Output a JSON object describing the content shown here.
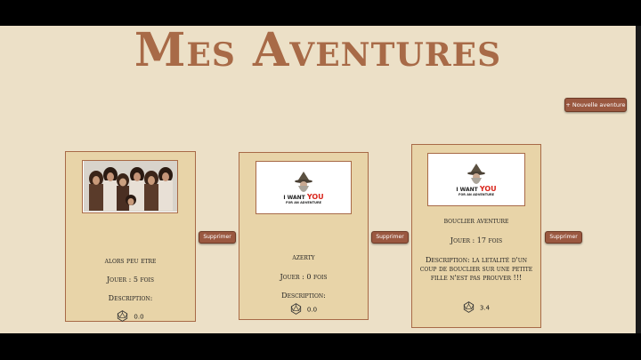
{
  "page": {
    "title": "Mes Aventures",
    "new_adventure_label": "+ Nouvelle aventure"
  },
  "cards": [
    {
      "name": "alors peu etre",
      "played": "Jouer : 5 fois",
      "description": "Description:",
      "rating": "0.0",
      "image": "group-photo",
      "delete_label": "Supprimer"
    },
    {
      "name": "azerty",
      "played": "Jouer : 0 fois",
      "description": "Description:",
      "rating": "0.0",
      "image": "gandalf-wanted",
      "delete_label": "Supprimer"
    },
    {
      "name": "bouclier aventure",
      "played": "Jouer : 17 fois",
      "description": "Description: la letalité d'un coup de bouclier sur une petite fille n'est pas prouver !!!",
      "rating": "3.4",
      "image": "gandalf-wanted",
      "delete_label": "Supprimer"
    }
  ],
  "poster_text": {
    "line1": "I WANT",
    "you": "YOU",
    "line2": "FOR AN ADVENTURE"
  },
  "colors": {
    "background": "#ece0c7",
    "card": "#e8d4a8",
    "accent": "#a86a47",
    "button": "#9a5840"
  }
}
